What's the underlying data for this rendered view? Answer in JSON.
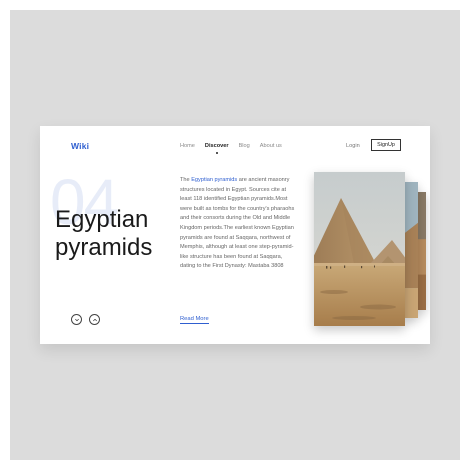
{
  "header": {
    "logo": "Wiki",
    "nav": [
      {
        "label": "Home",
        "active": false
      },
      {
        "label": "Discover",
        "active": true
      },
      {
        "label": "Blog",
        "active": false
      },
      {
        "label": "About us",
        "active": false
      }
    ],
    "login_label": "Login",
    "signup_label": "SignUp"
  },
  "hero": {
    "number": "04",
    "title_line1": "Egyptian",
    "title_line2": "pyramids",
    "description_prefix": "The ",
    "description_link": "Egyptian pyramids",
    "description_rest": " are ancient masonry structures located in Egypt. Sources cite at least 118 identified Egyptian pyramids.Most were built as tombs for the country's pharaohs and their consorts during the Old and Middle Kingdom periods.The earliest known Egyptian pyramids are found at Saqqara, northwest of Memphis, although at least one step-pyramid-like structure has been found at Saqqara, dating to the First Dynasty: Mastaba 3808",
    "read_more": "Read More"
  },
  "controls": {
    "prev_icon": "chevron-down-icon",
    "next_icon": "chevron-up-icon"
  },
  "colors": {
    "accent": "#2f5fd0",
    "background": "#dcdcdc",
    "card": "#ffffff",
    "number_watermark": "#e7ecf8"
  }
}
